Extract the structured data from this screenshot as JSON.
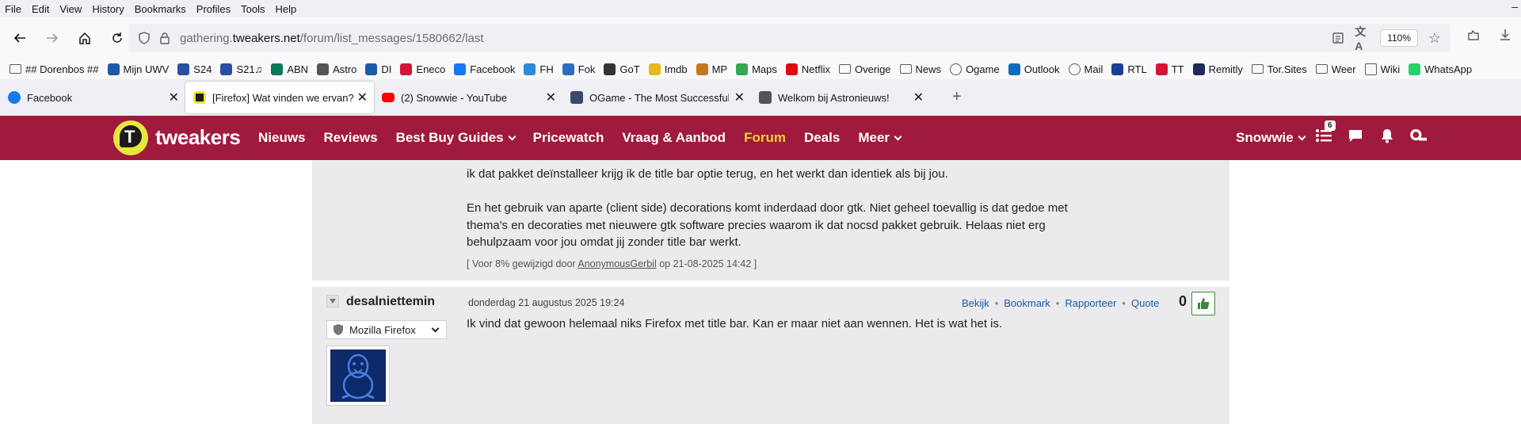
{
  "menubar": [
    "File",
    "Edit",
    "View",
    "History",
    "Bookmarks",
    "Profiles",
    "Tools",
    "Help"
  ],
  "navbar": {
    "url_prefix": "gathering.",
    "url_domain": "tweakers.net",
    "url_path": "/forum/list_messages/1580662/last",
    "zoom": "110%"
  },
  "bookmarks": [
    {
      "label": "## Dorenbos ##",
      "icon": "folder",
      "color": ""
    },
    {
      "label": "Mijn UWV",
      "icon": "uwv-icon",
      "color": "#1d5aa8"
    },
    {
      "label": "S24",
      "icon": "s24-icon",
      "color": "#2a4fa0"
    },
    {
      "label": "S21♫",
      "icon": "s21-icon",
      "color": "#2a4fa0"
    },
    {
      "label": "ABN",
      "icon": "abn-icon",
      "color": "#0a7a5a"
    },
    {
      "label": "Astro",
      "icon": "astro-icon",
      "color": "#555555"
    },
    {
      "label": "DI",
      "icon": "di-icon",
      "color": "#1d5aa8"
    },
    {
      "label": "Eneco",
      "icon": "eneco-icon",
      "color": "#d4143a"
    },
    {
      "label": "Facebook",
      "icon": "facebook-icon",
      "color": "#1877f2"
    },
    {
      "label": "FH",
      "icon": "fh-icon",
      "color": "#2f8bd6"
    },
    {
      "label": "Fok",
      "icon": "fok-icon",
      "color": "#2a6fc0"
    },
    {
      "label": "GoT",
      "icon": "got-icon",
      "color": "#333333"
    },
    {
      "label": "Imdb",
      "icon": "imdb-icon",
      "color": "#e6b91e"
    },
    {
      "label": "MP",
      "icon": "mp-icon",
      "color": "#c7761f"
    },
    {
      "label": "Maps",
      "icon": "maps-icon",
      "color": "#34a853"
    },
    {
      "label": "Netflix",
      "icon": "netflix-icon",
      "color": "#e50914"
    },
    {
      "label": "Overige",
      "icon": "folder",
      "color": ""
    },
    {
      "label": "News",
      "icon": "folder",
      "color": ""
    },
    {
      "label": "Ogame",
      "icon": "globe-icon",
      "color": ""
    },
    {
      "label": "Outlook",
      "icon": "outlook-icon",
      "color": "#0f6cbd"
    },
    {
      "label": "Mail",
      "icon": "globe-icon",
      "color": ""
    },
    {
      "label": "RTL",
      "icon": "rtl-icon",
      "color": "#1c3f94"
    },
    {
      "label": "TT",
      "icon": "tt-icon",
      "color": "#d4143a"
    },
    {
      "label": "Remitly",
      "icon": "remitly-icon",
      "color": "#1c2b5a"
    },
    {
      "label": "Tor.Sites",
      "icon": "folder",
      "color": ""
    },
    {
      "label": "Weer",
      "icon": "folder",
      "color": ""
    },
    {
      "label": "Wiki",
      "icon": "wiki-icon",
      "color": ""
    },
    {
      "label": "WhatsApp",
      "icon": "whatsapp-icon",
      "color": "#25d366"
    }
  ],
  "tabs": [
    {
      "label": "Facebook",
      "icon": "facebook-icon",
      "color": "#1877f2",
      "active": false
    },
    {
      "label": "[Firefox] Wat vinden we ervan?",
      "icon": "tweakers-icon",
      "color": "#e8e83c",
      "active": true
    },
    {
      "label": "(2) Snowwie - YouTube",
      "icon": "youtube-icon",
      "color": "#ff0000",
      "active": false
    },
    {
      "label": "OGame - The Most Successful B",
      "icon": "ogame-icon",
      "color": "#3a4a6a",
      "active": false
    },
    {
      "label": "Welkom bij Astronieuws!",
      "icon": "astronieuws-icon",
      "color": "#555555",
      "active": false
    }
  ],
  "site": {
    "brand": "tweakers",
    "logo_letter": "T",
    "nav": [
      {
        "label": "Nieuws",
        "dropdown": false
      },
      {
        "label": "Reviews",
        "dropdown": false
      },
      {
        "label": "Best Buy Guides",
        "dropdown": true
      },
      {
        "label": "Pricewatch",
        "dropdown": false
      },
      {
        "label": "Vraag & Aanbod",
        "dropdown": false
      },
      {
        "label": "Forum",
        "dropdown": false
      },
      {
        "label": "Deals",
        "dropdown": false
      },
      {
        "label": "Meer",
        "dropdown": true
      }
    ],
    "user": "Snowwie",
    "notification_count": "6",
    "colors": {
      "header": "#a01a3d",
      "forum_active": "#f3d02b"
    }
  },
  "post1": {
    "line1": "ik dat pakket deïnstalleer krijg ik de title bar optie terug, en het werkt dan identiek als bij jou.",
    "para2": "En het gebruik van aparte (client side) decorations komt inderdaad door gtk. Niet geheel toevallig is dat gedoe met thema's en decoraties met nieuwere gtk software precies waarom ik dat nocsd pakket gebruik. Helaas niet erg behulpzaam voor jou omdat jij zonder title bar werkt.",
    "edit_prefix": "[ Voor 8% gewijzigd door ",
    "edit_user": "AnonymousGerbil",
    "edit_suffix": " op 21-08-2025 14:42 ]"
  },
  "post2": {
    "author": "desalniettemin",
    "date": "donderdag 21 augustus 2025 19:24",
    "actions": [
      "Bekijk",
      "Bookmark",
      "Rapporteer",
      "Quote"
    ],
    "score": "0",
    "select_value": "Mozilla Firefox",
    "message": "Ik vind dat gewoon helemaal niks Firefox met title bar. Kan er maar niet aan wennen. Het is wat het is."
  }
}
